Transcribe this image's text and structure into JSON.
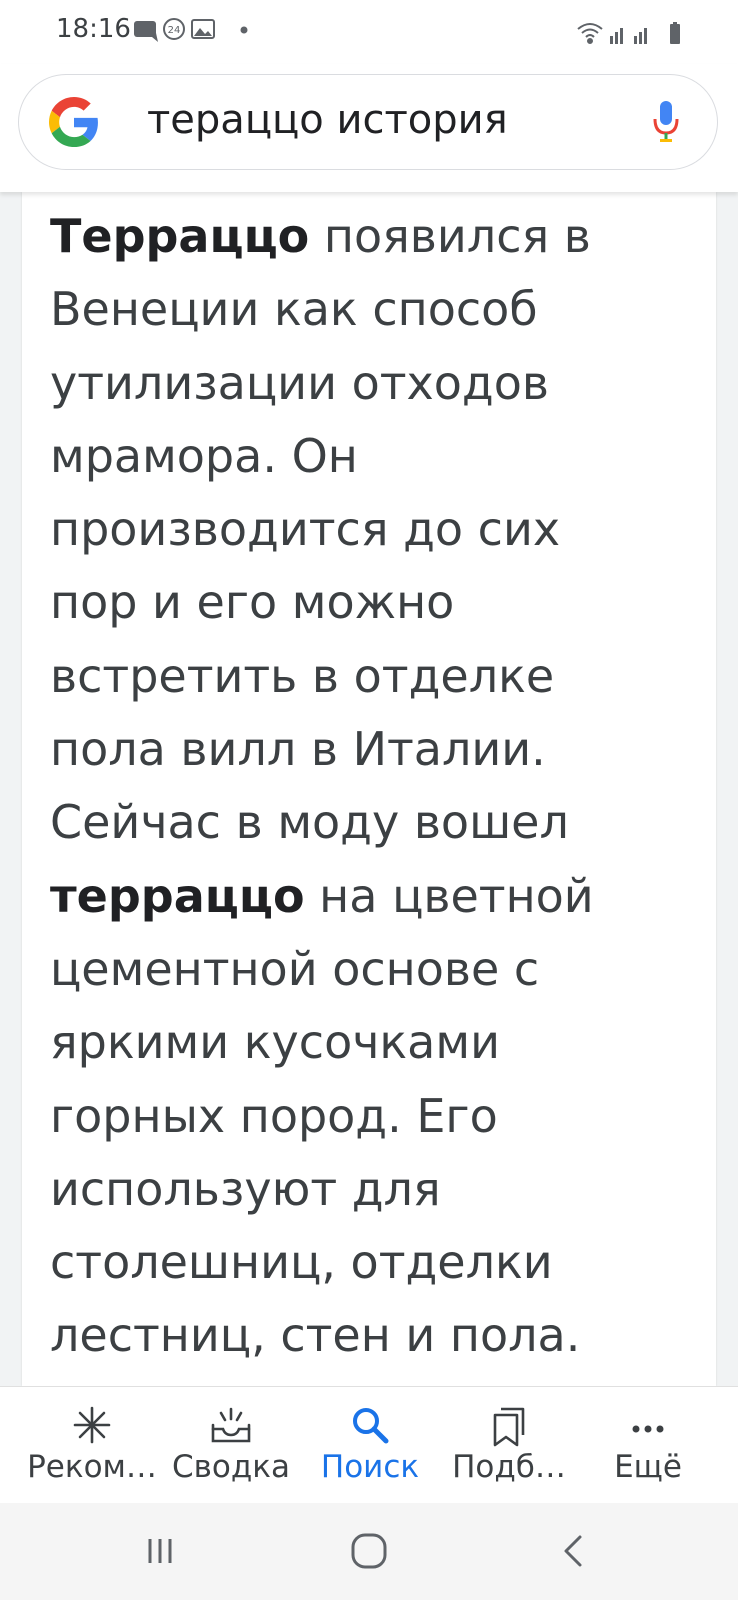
{
  "status_bar": {
    "time": "18:16",
    "left_icons": [
      "message-icon",
      "clock-24-icon",
      "image-icon",
      "dot-icon"
    ],
    "right_icons": [
      "wifi-icon",
      "signal-icon",
      "signal-icon",
      "battery-icon"
    ]
  },
  "search": {
    "query": "тераццо история",
    "logo": "google-g-logo",
    "mic": "mic-icon"
  },
  "snippet": {
    "lines": [
      {
        "bold": "Терраццо",
        "text": " появился в"
      },
      {
        "bold": "",
        "text": "Венеции как способ"
      },
      {
        "bold": "",
        "text": "утилизации отходов"
      },
      {
        "bold": "",
        "text": "мрамора. Он"
      },
      {
        "bold": "",
        "text": "производится до сих"
      },
      {
        "bold": "",
        "text": "пор и его можно"
      },
      {
        "bold": "",
        "text": "встретить в отделке"
      },
      {
        "bold": "",
        "text": "пола вилл в Италии."
      },
      {
        "bold": "",
        "text": "Сейчас в моду вошел"
      },
      {
        "bold": "терраццо",
        "text": " на цветной"
      },
      {
        "bold": "",
        "text": "цементной основе с"
      },
      {
        "bold": "",
        "text": "яркими кусочками"
      },
      {
        "bold": "",
        "text": "горных пород. Его"
      },
      {
        "bold": "",
        "text": "используют для"
      },
      {
        "bold": "",
        "text": "столешниц, отделки"
      },
      {
        "bold": "",
        "text": "лестниц, стен и пола."
      }
    ]
  },
  "bottom_nav": {
    "items": [
      {
        "label": "Реком…",
        "icon": "asterisk-icon",
        "active": false
      },
      {
        "label": "Сводка",
        "icon": "inbox-icon",
        "active": false
      },
      {
        "label": "Поиск",
        "icon": "search-icon",
        "active": true
      },
      {
        "label": "Подб…",
        "icon": "collections-icon",
        "active": false
      },
      {
        "label": "Ещё",
        "icon": "more-icon",
        "active": false
      }
    ],
    "active_color": "#1a73e8"
  },
  "system_nav": [
    "recents-icon",
    "home-icon",
    "back-icon"
  ]
}
